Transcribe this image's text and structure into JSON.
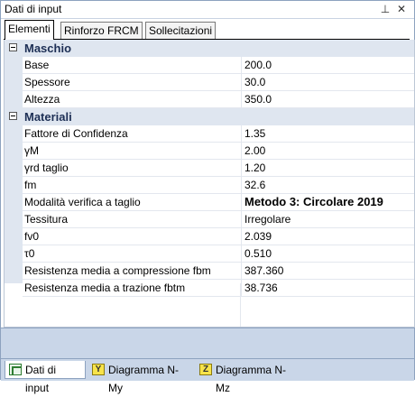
{
  "window": {
    "title": "Dati di input",
    "pin_icon": "pin-icon",
    "close_icon": "close-icon"
  },
  "tabs": [
    {
      "label": "Elementi",
      "active": true
    },
    {
      "label": "Rinforzo FRCM",
      "active": false
    },
    {
      "label": "Sollecitazioni",
      "active": false
    }
  ],
  "grid": {
    "categories": [
      {
        "label": "Maschio",
        "rows": [
          {
            "name": "Base",
            "value": "200.0"
          },
          {
            "name": "Spessore",
            "value": "30.0"
          },
          {
            "name": "Altezza",
            "value": "350.0"
          }
        ]
      },
      {
        "label": "Materiali",
        "rows": [
          {
            "name": "Fattore di Confidenza",
            "value": "1.35"
          },
          {
            "name": "γM",
            "value": "2.00"
          },
          {
            "name": "γrd taglio",
            "value": "1.20"
          },
          {
            "name": "fm",
            "value": "32.6"
          },
          {
            "name": "Modalità verifica a taglio",
            "value": "Metodo 3: Circolare 2019"
          },
          {
            "name": "Tessitura",
            "value": "Irregolare"
          },
          {
            "name": "fv0",
            "value": "2.039"
          },
          {
            "name": "τ0",
            "value": "0.510"
          },
          {
            "name": "Resistenza media a compressione fbm",
            "value": "387.360"
          },
          {
            "name": "Resistenza media a trazione fbtm",
            "value": "38.736"
          }
        ]
      }
    ]
  },
  "bottom_tabs": [
    {
      "label": "Dati di input",
      "icon": "table-icon",
      "active": true
    },
    {
      "label": "Diagramma N-My",
      "icon": "y-diagram-icon",
      "icon_letter": "Y",
      "active": false
    },
    {
      "label": "Diagramma N-Mz",
      "icon": "z-diagram-icon",
      "icon_letter": "Z",
      "active": false
    }
  ],
  "colors": {
    "category_band": "#dfe6f0",
    "bottom_bar": "#c9d6e8",
    "accent_border": "#8da2bf"
  }
}
